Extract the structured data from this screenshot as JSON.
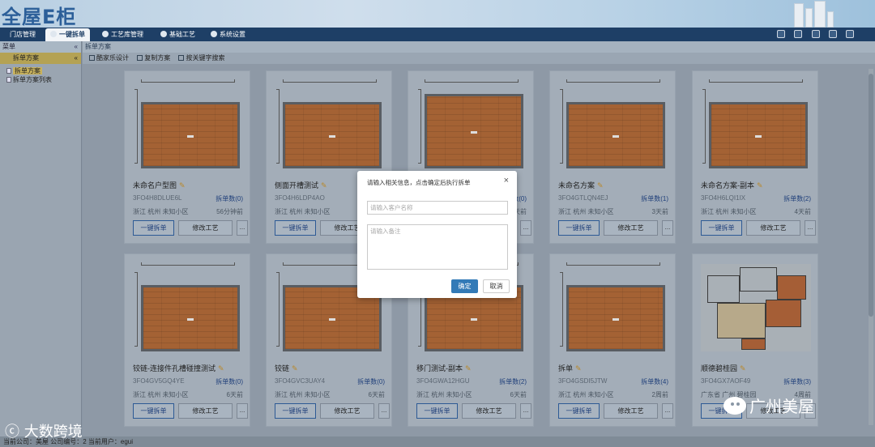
{
  "app": {
    "logo": "全屋E柜"
  },
  "nav": {
    "tabs": [
      {
        "label": "门店管理"
      },
      {
        "label": "一键拆单"
      },
      {
        "label": "工艺库管理"
      },
      {
        "label": "基础工艺"
      },
      {
        "label": "系统设置"
      }
    ],
    "active_tab": "一键拆单"
  },
  "sidebar": {
    "header": "菜单",
    "collapse_glyph": "«",
    "section": "拆单方案",
    "section_glyph": "«",
    "items": [
      {
        "label": "拆单方案"
      },
      {
        "label": "拆单方案列表"
      }
    ]
  },
  "main": {
    "breadcrumb": "拆单方案",
    "toolbar": [
      {
        "label": "酷家乐设计"
      },
      {
        "label": "复制方案"
      },
      {
        "label": "按关键字搜索"
      }
    ]
  },
  "cards": [
    {
      "title": "未命名户型图",
      "code": "3FO4H8DLUE6L",
      "count": "拆单数(0)",
      "location": "浙江 杭州 未知小区",
      "time": "56分钟前",
      "plan": "floor"
    },
    {
      "title": "侧面开槽测试",
      "code": "3FO4H6LDP4AO",
      "count": "拆单数(0)",
      "location": "浙江 杭州 未知小区",
      "time": "1天前",
      "plan": "floor"
    },
    {
      "title": "",
      "code": "",
      "count": "拆单数(0)",
      "location": "",
      "time": "3天前",
      "plan": "floor-tall"
    },
    {
      "title": "未命名方案",
      "code": "3FO4GTLQN4EJ",
      "count": "拆单数(1)",
      "location": "浙江 杭州 未知小区",
      "time": "3天前",
      "plan": "floor"
    },
    {
      "title": "未命名方案-副本",
      "code": "3FO4H6LQI1IX",
      "count": "拆单数(2)",
      "location": "浙江 杭州 未知小区",
      "time": "4天前",
      "plan": "floor"
    },
    {
      "title": "铰链-连接件孔槽碰撞测试",
      "code": "3FO4GV5GQ4YE",
      "count": "拆单数(0)",
      "location": "浙江 杭州 未知小区",
      "time": "6天前",
      "plan": "floor"
    },
    {
      "title": "铰链",
      "code": "3FO4GVC3UAY4",
      "count": "拆单数(0)",
      "location": "浙江 杭州 未知小区",
      "time": "6天前",
      "plan": "floor"
    },
    {
      "title": "移门测试-副本",
      "code": "3FO4GWA12HGU",
      "count": "拆单数(2)",
      "location": "浙江 杭州 未知小区",
      "time": "6天前",
      "plan": "floor"
    },
    {
      "title": "拆单",
      "code": "3FO4GSDI5JTW",
      "count": "拆单数(4)",
      "location": "浙江 杭州 未知小区",
      "time": "2周前",
      "plan": "floor"
    },
    {
      "title": "顺德碧桂园",
      "code": "3FO4GX7AOF49",
      "count": "拆单数(3)",
      "location": "广东省 广州 碧桂园",
      "time": "4周前",
      "plan": "layout"
    }
  ],
  "card_buttons": {
    "split": "一键拆单",
    "craft": "修改工艺",
    "more": "..."
  },
  "dialog": {
    "title": "请输入相关信息，点击确定后执行拆单",
    "close": "×",
    "name_placeholder": "请输入客户名称",
    "remark_placeholder": "请输入备注",
    "ok": "确定",
    "cancel": "取消"
  },
  "status_bar": "当前公司：美屋 公司编号：2 当前用户：egui",
  "watermarks": {
    "left": "大数跨境",
    "right": "广州美屋"
  },
  "colors": {
    "nav": "#1e3f66",
    "primary": "#337ab7",
    "floor": "#a46234"
  }
}
